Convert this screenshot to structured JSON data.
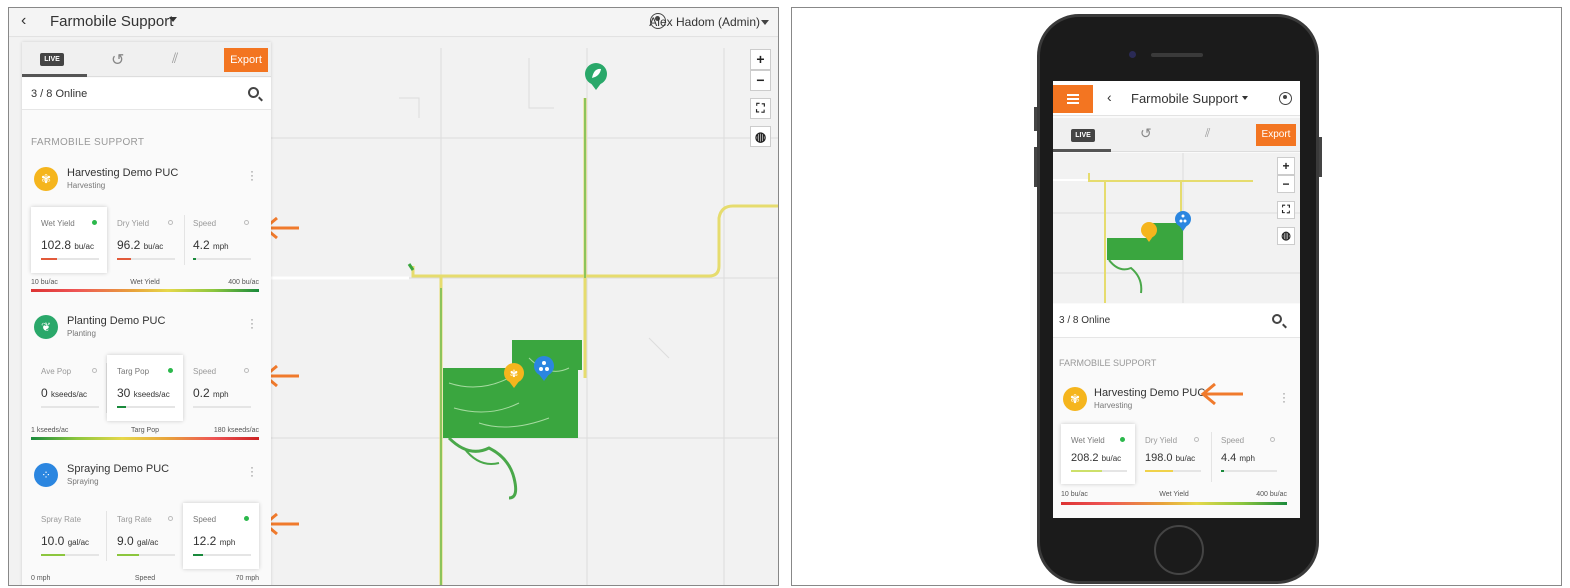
{
  "left": {
    "topbar": {
      "back_glyph": "‹",
      "title": "Farmobile Support",
      "user": "Alex Hadom (Admin)"
    },
    "tabs": {
      "live": "LIVE",
      "history_icon": "history-icon",
      "stripes_icon": "field-layers-icon",
      "export": "Export"
    },
    "online": "3 / 8 Online",
    "group_title": "FARMOBILE SUPPORT",
    "vehicles": [
      {
        "name": "Harvesting Demo PUC",
        "operation": "Harvesting",
        "color": "#f5b51d",
        "icon": "wheat-icon",
        "tiles": [
          {
            "label": "Wet Yield",
            "value": "102.8",
            "unit": "bu/ac",
            "active": true,
            "bar_pct": 0.28,
            "bar_color": "#e25a3a"
          },
          {
            "label": "Dry Yield",
            "value": "96.2",
            "unit": "bu/ac",
            "active": false,
            "bar_pct": 0.24,
            "bar_color": "#e25a3a"
          },
          {
            "label": "Speed",
            "value": "4.2",
            "unit": "mph",
            "active": false,
            "bar_pct": 0.06,
            "bar_color": "#1a8a3c"
          }
        ],
        "scale": {
          "min": "10 bu/ac",
          "mid": "Wet Yield",
          "max": "400 bu/ac"
        }
      },
      {
        "name": "Planting Demo PUC",
        "operation": "Planting",
        "color": "#2aa86a",
        "icon": "leaf-icon",
        "tiles": [
          {
            "label": "Ave Pop",
            "value": "0",
            "unit": "kseeds/ac",
            "active": false,
            "bar_pct": 0,
            "bar_color": "#1a8a3c"
          },
          {
            "label": "Targ Pop",
            "value": "30",
            "unit": "kseeds/ac",
            "active": true,
            "bar_pct": 0.16,
            "bar_color": "#1a8a3c"
          },
          {
            "label": "Speed",
            "value": "0.2",
            "unit": "mph",
            "active": false,
            "bar_pct": 0.02,
            "bar_color": "#1a8a3c"
          }
        ],
        "scale": {
          "min": "1 kseeds/ac",
          "mid": "Targ Pop",
          "max": "180 kseeds/ac"
        }
      },
      {
        "name": "Spraying Demo PUC",
        "operation": "Spraying",
        "color": "#2b86e0",
        "icon": "spray-drops-icon",
        "tiles": [
          {
            "label": "Spray Rate",
            "value": "10.0",
            "unit": "gal/ac",
            "active": false,
            "bar_pct": 0.42,
            "bar_color": "#8cc63e"
          },
          {
            "label": "Targ Rate",
            "value": "9.0",
            "unit": "gal/ac",
            "active": false,
            "bar_pct": 0.38,
            "bar_color": "#8cc63e"
          },
          {
            "label": "Speed",
            "value": "12.2",
            "unit": "mph",
            "active": true,
            "bar_pct": 0.18,
            "bar_color": "#1a8a3c"
          }
        ],
        "scale": {
          "min": "0 mph",
          "mid": "Speed",
          "max": "70 mph"
        }
      }
    ]
  },
  "right": {
    "topbar": {
      "back_glyph": "‹",
      "title": "Farmobile Support"
    },
    "tabs": {
      "live": "LIVE",
      "export": "Export"
    },
    "online": "3 / 8 Online",
    "group_title": "FARMOBILE SUPPORT",
    "vehicle": {
      "name": "Harvesting Demo PUC",
      "operation": "Harvesting",
      "color": "#f5b51d",
      "tiles": [
        {
          "label": "Wet Yield",
          "value": "208.2",
          "unit": "bu/ac",
          "active": true,
          "bar_pct": 0.55,
          "bar_color": "#cde06a"
        },
        {
          "label": "Dry Yield",
          "value": "198.0",
          "unit": "bu/ac",
          "active": false,
          "bar_pct": 0.5,
          "bar_color": "#f0d24a"
        },
        {
          "label": "Speed",
          "value": "4.4",
          "unit": "mph",
          "active": false,
          "bar_pct": 0.06,
          "bar_color": "#1a8a3c"
        }
      ],
      "scale": {
        "min": "10 bu/ac",
        "mid": "Wet Yield",
        "max": "400 bu/ac"
      }
    }
  },
  "map_controls": {
    "zoom_in": "+",
    "zoom_out": "−"
  },
  "colors": {
    "accent": "#f37521",
    "field_green": "#3aa63f",
    "road_yellow": "#e6dc6e"
  }
}
